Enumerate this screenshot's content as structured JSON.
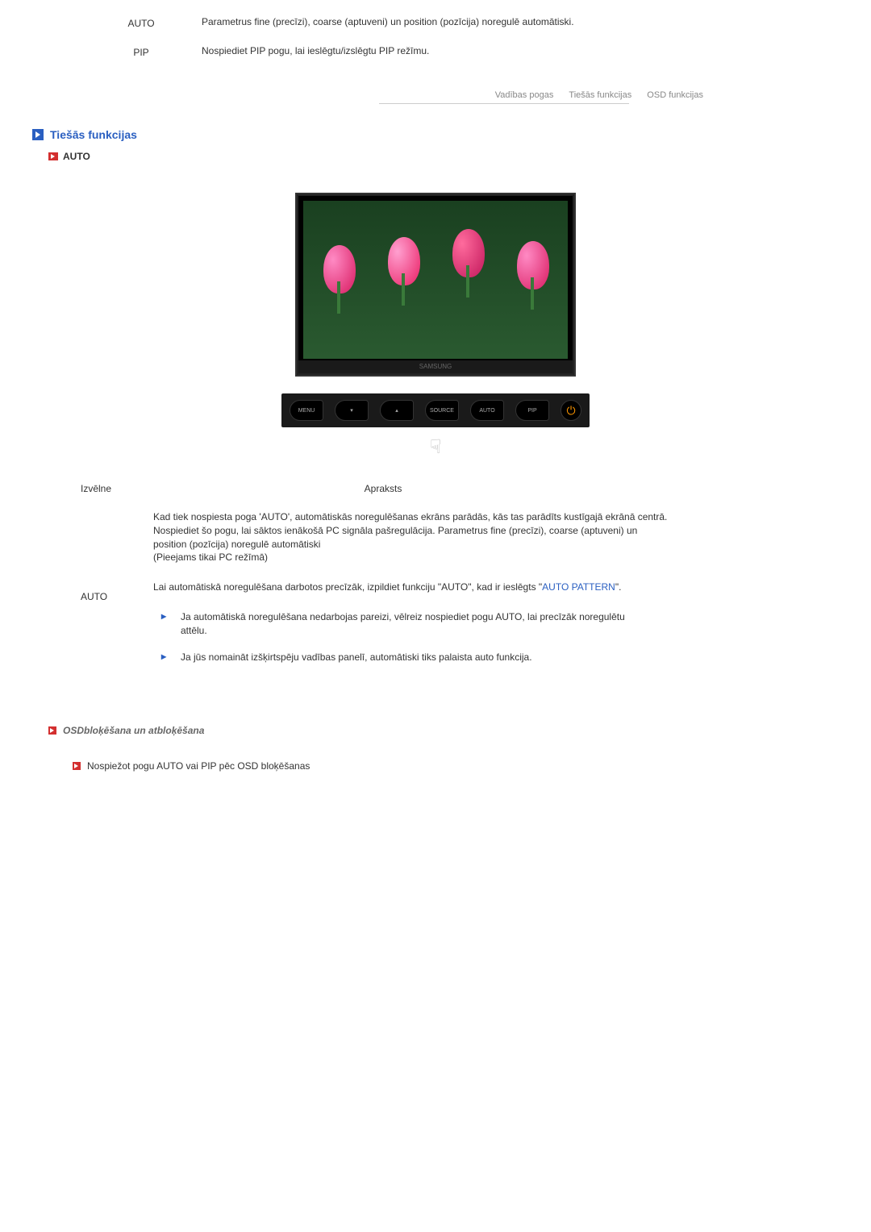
{
  "top_rows": [
    {
      "label": "AUTO",
      "desc": "Parametrus fine (precīzi), coarse (aptuveni) un position (pozīcija) noregulē automātiski."
    },
    {
      "label": "PIP",
      "desc": "Nospiediet PIP pogu, lai ieslēgtu/izslēgtu PIP režīmu."
    }
  ],
  "tabs": {
    "t1": "Vadības pogas",
    "t2": "Tiešās funkcijas",
    "t3": "OSD funkcijas"
  },
  "section": {
    "title": "Tiešās funkcijas",
    "sub": "AUTO"
  },
  "monitor_brand": "SAMSUNG",
  "panel_buttons": {
    "menu": "MENU",
    "down": "▾",
    "up": "▴",
    "source": "SOURCE",
    "auto": "AUTO",
    "pip": "PIP",
    "power": "⏻"
  },
  "desc_header": {
    "col1": "Izvēlne",
    "col2": "Apraksts"
  },
  "auto_block": {
    "label": "AUTO",
    "para1": "Kad tiek nospiesta poga 'AUTO', automātiskās noregulēšanas ekrāns parādās, kās tas parādīts kustīgajā ekrānā centrā. Nospiediet šo pogu, lai sāktos ienākošā PC signāla pašregulācija. Parametrus fine (precīzi), coarse (aptuveni) un position (pozīcija) noregulē automātiski",
    "para1b": "(Pieejams tikai PC režīmā)",
    "para2a": "Lai automātiskā noregulēšana darbotos precīzāk, izpildiet funkciju ",
    "para2b": "AUTO",
    "para2c": ", kad ir ieslēgts ",
    "link": "AUTO PATTERN",
    "para2d": ".",
    "bullets": [
      "Ja automātiskā noregulēšana nedarbojas pareizi, vēlreiz nospiediet pogu AUTO, lai precīzāk noregulētu attēlu.",
      "Ja jūs nomaināt izšķirtspēju vadības panelī, automātiski tiks palaista auto funkcija."
    ]
  },
  "osd": {
    "prefix": "OSD",
    "title": " bloķēšana un atbloķēšana",
    "sub": "Nospiežot pogu AUTO vai PIP pēc OSD bloķēšanas"
  }
}
